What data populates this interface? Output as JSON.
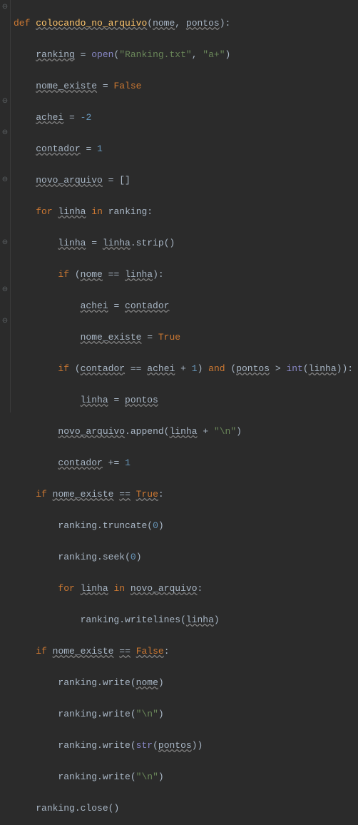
{
  "code": {
    "l1_def": "def",
    "l1_fn": "colocando_no_arquivo",
    "l1_p1": "nome",
    "l1_p2": "pontos",
    "l2_var": "ranking",
    "l2_open": "open",
    "l2_s1": "\"Ranking.txt\"",
    "l2_s2": "\"a+\"",
    "l3_var": "nome_existe",
    "l3_val": "False",
    "l4_var": "achei",
    "l4_val": "-2",
    "l5_var": "contador",
    "l5_val": "1",
    "l6_var": "novo_arquivo",
    "l6_val": "[]",
    "l7_for": "for",
    "l7_var": "linha",
    "l7_in": "in",
    "l7_iter": "ranking",
    "l8_var": "linha",
    "l8_obj": "linha",
    "l8_m": "strip",
    "l9_if": "if",
    "l9_a": "nome",
    "l9_eq": "==",
    "l9_b": "linha",
    "l10_var": "achei",
    "l10_val": "contador",
    "l11_var": "nome_existe",
    "l11_val": "True",
    "l12_if": "if",
    "l12_a": "contador",
    "l12_eq": "==",
    "l12_b": "achei",
    "l12_plus": "+",
    "l12_one": "1",
    "l12_and": "and",
    "l12_c": "pontos",
    "l12_gt": ">",
    "l12_int": "int",
    "l12_d": "linha",
    "l13_var": "linha",
    "l13_val": "pontos",
    "l14_obj": "novo_arquivo",
    "l14_m": "append",
    "l14_arg": "linha",
    "l14_plus": "+",
    "l14_s": "\"\\n\"",
    "l15_var": "contador",
    "l15_op": "+=",
    "l15_val": "1",
    "l16_if": "if",
    "l16_var": "nome_existe",
    "l16_eq": "==",
    "l16_val": "True",
    "l17_obj": "ranking",
    "l17_m": "truncate",
    "l17_arg": "0",
    "l18_obj": "ranking",
    "l18_m": "seek",
    "l18_arg": "0",
    "l19_for": "for",
    "l19_var": "linha",
    "l19_in": "in",
    "l19_iter": "novo_arquivo",
    "l20_obj": "ranking",
    "l20_m": "writelines",
    "l20_arg": "linha",
    "l21_if": "if",
    "l21_var": "nome_existe",
    "l21_eq": "==",
    "l21_val": "False",
    "l22_obj": "ranking",
    "l22_m": "write",
    "l22_arg": "nome",
    "l23_obj": "ranking",
    "l23_m": "write",
    "l23_arg": "\"\\n\"",
    "l24_obj": "ranking",
    "l24_m": "write",
    "l24_str": "str",
    "l24_arg": "pontos",
    "l25_obj": "ranking",
    "l25_m": "write",
    "l25_arg": "\"\\n\"",
    "l26_obj": "ranking",
    "l26_m": "close"
  },
  "gutter_glyph": "⊖"
}
